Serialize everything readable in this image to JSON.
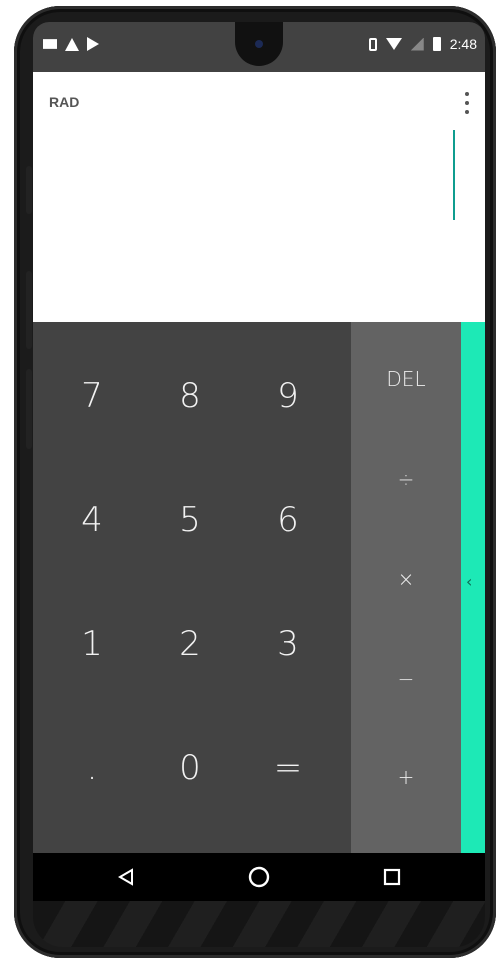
{
  "status_bar": {
    "time": "2:48",
    "left_icons": [
      "image-icon",
      "warning-icon",
      "play-store-icon"
    ],
    "right_icons": [
      "vibrate-icon",
      "wifi-icon",
      "no-signal-icon",
      "battery-icon"
    ]
  },
  "display": {
    "angle_mode": "RAD",
    "formula": "",
    "menu_icon": "more-vert-icon",
    "cursor_color": "#0f9d8f"
  },
  "keypad": {
    "digits": [
      [
        "7",
        "8",
        "9"
      ],
      [
        "4",
        "5",
        "6"
      ],
      [
        "1",
        "2",
        "3"
      ],
      [
        ".",
        "0",
        "="
      ]
    ],
    "operators": [
      "DEL",
      "÷",
      "×",
      "−",
      "+"
    ],
    "advanced_panel_icon": "chevron-left-icon",
    "colors": {
      "digits_bg": "#434343",
      "operators_bg": "#636363",
      "advanced_bg": "#1de9b6"
    }
  },
  "nav_bar": {
    "buttons": [
      "back-icon",
      "home-icon",
      "recents-icon"
    ]
  }
}
